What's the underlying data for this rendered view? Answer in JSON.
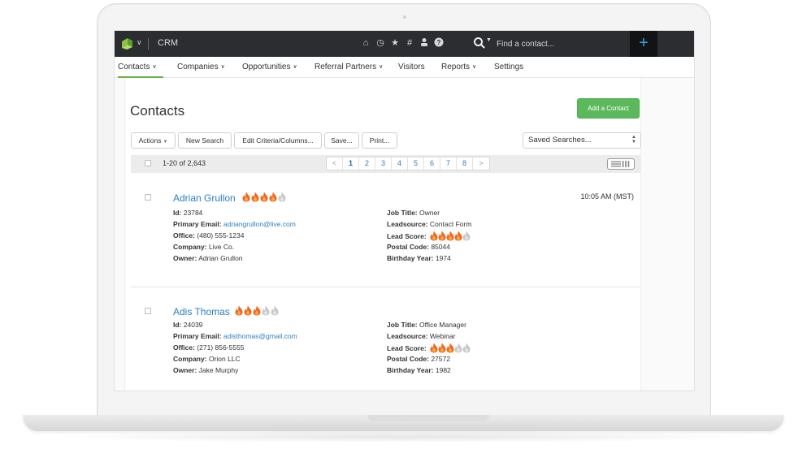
{
  "app": {
    "name": "CRM",
    "search_placeholder": "Find a contact...",
    "add_label": "+",
    "toolbar_icons": [
      "home-icon",
      "history-icon",
      "star-icon",
      "hashtag-icon",
      "user-icon",
      "help-icon"
    ]
  },
  "nav": {
    "items": [
      {
        "label": "Contacts",
        "has_menu": true,
        "active": true
      },
      {
        "label": "Companies",
        "has_menu": true
      },
      {
        "label": "Opportunities",
        "has_menu": true
      },
      {
        "label": "Referral Partners",
        "has_menu": true
      },
      {
        "label": "Visitors",
        "has_menu": false
      },
      {
        "label": "Reports",
        "has_menu": true
      },
      {
        "label": "Settings",
        "has_menu": false
      }
    ]
  },
  "page": {
    "title": "Contacts",
    "add_button": "Add a Contact"
  },
  "toolbar": {
    "actions": "Actions",
    "new_search": "New Search",
    "edit_criteria": "Edit Criteria/Columns...",
    "save": "Save...",
    "print": "Print...",
    "saved_searches": "Saved Searches..."
  },
  "list": {
    "count": "1-20 of 2,643",
    "pages": [
      "<",
      "1",
      "2",
      "3",
      "4",
      "5",
      "6",
      "7",
      "8",
      ">"
    ],
    "current_page": "1"
  },
  "labels": {
    "id": "Id:",
    "email": "Primary Email:",
    "office": "Office:",
    "company": "Company:",
    "owner": "Owner:",
    "job_title": "Job Title:",
    "leadsource": "Leadsource:",
    "lead_score": "Lead Score:",
    "postal_code": "Postal Code:",
    "birthday_year": "Birthday Year:"
  },
  "records": [
    {
      "name": "Adrian Grullon",
      "score": 4,
      "score_max": 5,
      "time": "10:05 AM (MST)",
      "id": "23784",
      "email": "adriangrullon@live.com",
      "office": "(480) 555-1234",
      "company": "Live Co.",
      "owner": "Adrian Grullon",
      "job_title": "Owner",
      "leadsource": "Contact Form",
      "postal_code": "85044",
      "birthday_year": "1974"
    },
    {
      "name": "Adis Thomas",
      "score": 3,
      "score_max": 5,
      "time": "",
      "id": "24039",
      "email": "adisthomas@gmail.com",
      "office": "(271) 856-5555",
      "company": "Orion LLC",
      "owner": "Jake Murphy",
      "job_title": "Office Manager",
      "leadsource": "Webinar",
      "postal_code": "27572",
      "birthday_year": "1982"
    }
  ],
  "colors": {
    "topbar": "#2b2d31",
    "accent_green": "#5cb85c",
    "link_blue": "#2a7fc2",
    "flame_active": "#f26522",
    "flame_inactive": "#c8c8c8"
  }
}
